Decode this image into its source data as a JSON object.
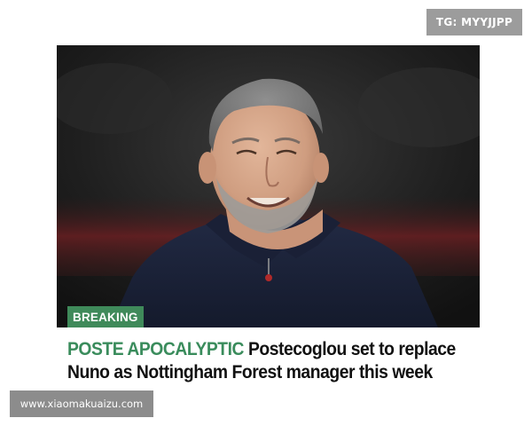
{
  "watermark_top": {
    "text": "TG: MYYJJPP"
  },
  "article": {
    "photo_alt": "Man smiling in navy polo shirt",
    "badge": "BREAKING",
    "kicker": "POSTE APOCALYPTIC",
    "headline": "Postecoglou set to replace Nuno as Nottingham Forest manager this week"
  },
  "watermark_bottom": {
    "text": "www.xiaomakuaizu.com"
  },
  "colors": {
    "badge_bg": "#3f8a5a",
    "kicker": "#3a8c5c",
    "headline": "#111111",
    "shirt": "#1c2338"
  }
}
